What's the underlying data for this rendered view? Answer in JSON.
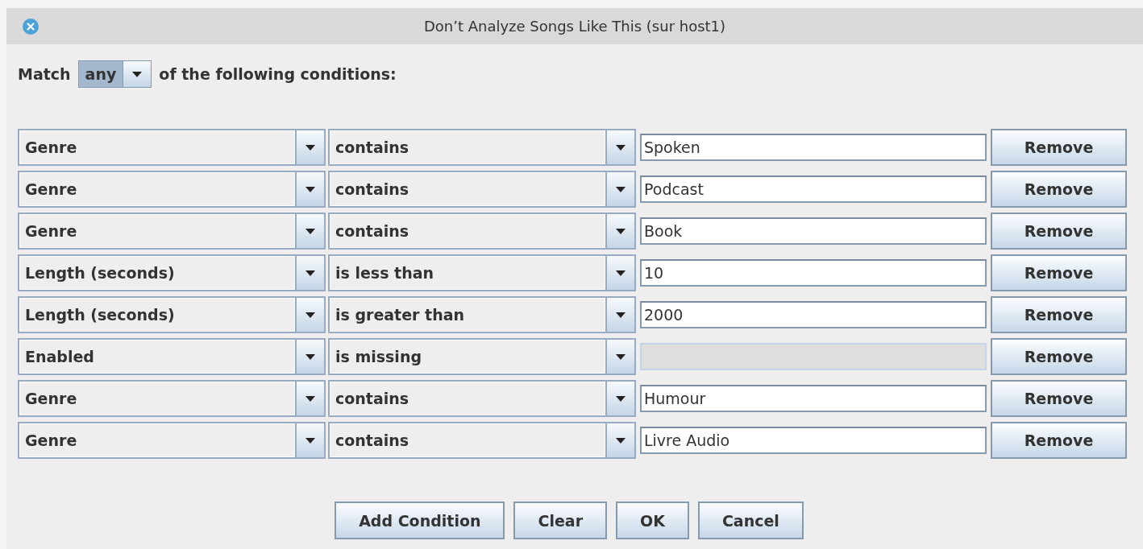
{
  "window": {
    "title": "Don’t Analyze Songs Like This (sur host1)"
  },
  "match": {
    "prefix": "Match",
    "value": "any",
    "suffix": "of the following conditions:"
  },
  "conditions": [
    {
      "field": "Genre",
      "operator": "contains",
      "value": "Spoken",
      "disabled": false,
      "remove": "Remove"
    },
    {
      "field": "Genre",
      "operator": "contains",
      "value": "Podcast",
      "disabled": false,
      "remove": "Remove"
    },
    {
      "field": "Genre",
      "operator": "contains",
      "value": "Book",
      "disabled": false,
      "remove": "Remove"
    },
    {
      "field": "Length (seconds)",
      "operator": "is less than",
      "value": "10",
      "disabled": false,
      "remove": "Remove"
    },
    {
      "field": "Length (seconds)",
      "operator": "is greater than",
      "value": "2000",
      "disabled": false,
      "remove": "Remove"
    },
    {
      "field": "Enabled",
      "operator": "is missing",
      "disabled": true,
      "remove": "Remove"
    },
    {
      "field": "Genre",
      "operator": "contains",
      "value": "Humour",
      "disabled": false,
      "remove": "Remove"
    },
    {
      "field": "Genre",
      "operator": "contains",
      "value": "Livre Audio",
      "disabled": false,
      "remove": "Remove"
    }
  ],
  "buttons": [
    "Add Condition",
    "Clear",
    "OK",
    "Cancel"
  ]
}
